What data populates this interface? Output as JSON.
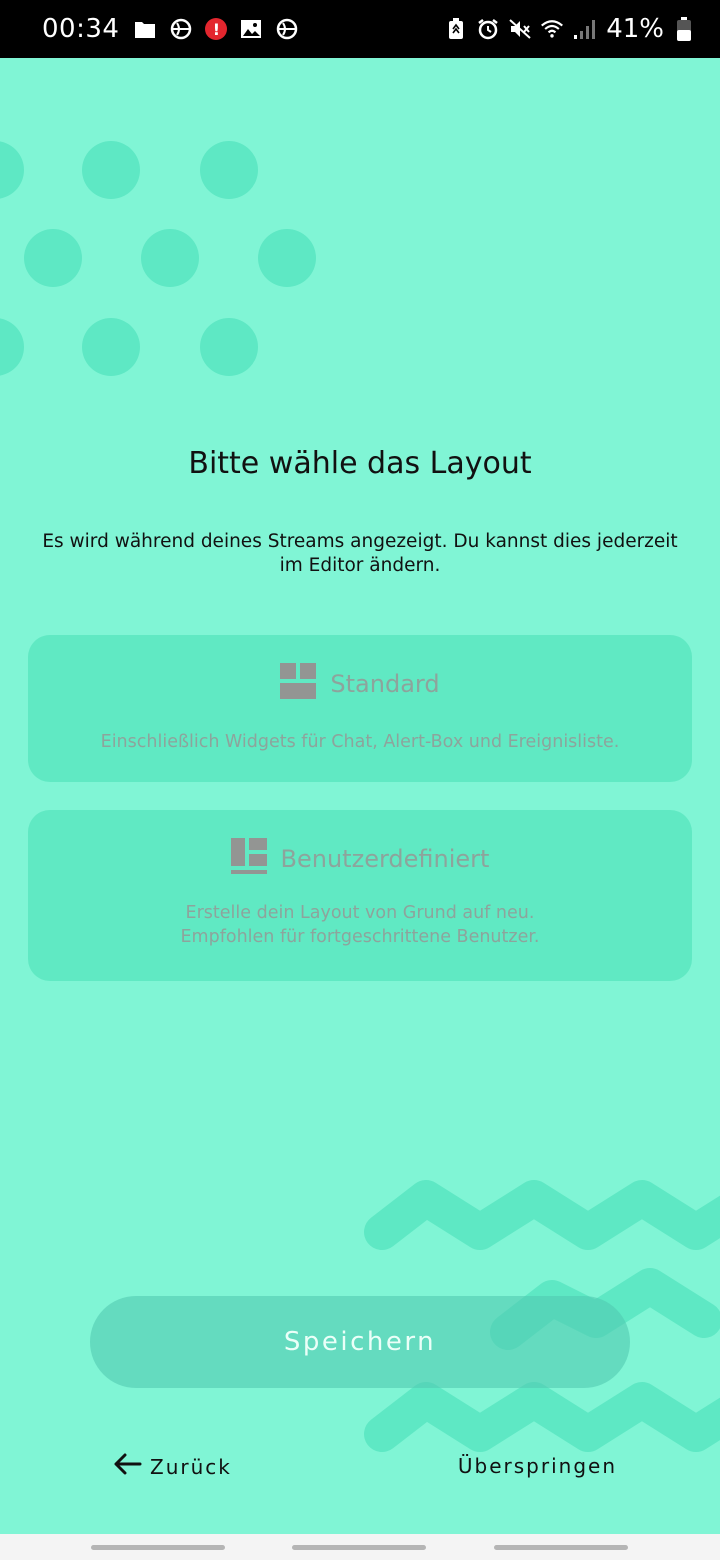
{
  "status_bar": {
    "time": "00:34",
    "battery_percent": "41%",
    "left_icons": [
      "folder-icon",
      "cast-icon",
      "alert-icon",
      "image-icon",
      "cast-icon"
    ],
    "alert_glyph": "!",
    "right_icons": [
      "battery-saver-icon",
      "alarm-icon",
      "mute-icon",
      "wifi-icon",
      "signal-icon",
      "battery-icon"
    ]
  },
  "main": {
    "title": "Bitte wähle das Layout",
    "subtitle": "Es wird während deines Streams angezeigt. Du kannst dies jederzeit im Editor ändern."
  },
  "options": [
    {
      "icon": "standard-layout-icon",
      "title": "Standard",
      "description_lines": [
        "Einschließlich Widgets für Chat, Alert-Box und Ereignisliste."
      ]
    },
    {
      "icon": "custom-layout-icon",
      "title": "Benutzerdefiniert",
      "description_lines": [
        "Erstelle dein Layout von Grund auf neu.",
        "Empfohlen für fortgeschrittene Benutzer."
      ]
    }
  ],
  "actions": {
    "save_label": "Speichern",
    "back_label": "Zurück",
    "skip_label": "Überspringen"
  },
  "colors": {
    "background": "#80f5d5",
    "card": "#60e9c3",
    "decoration": "#5ee8c4",
    "muted_text": "#8da49c",
    "status_bar": "#000000"
  }
}
